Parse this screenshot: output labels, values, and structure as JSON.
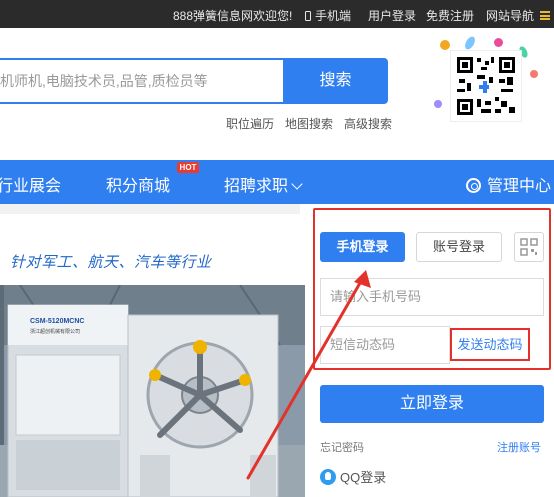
{
  "topbar": {
    "welcome": "888弹簧信息网欢迎您!",
    "mobile": "手机端",
    "login": "用户登录",
    "register": "免费注册",
    "sitenav": "网站导航",
    "menu_icon": "menu-icon",
    "phone_icon": "mobile-phone-icon"
  },
  "search": {
    "placeholder": "机师机,电脑技术员,品管,质检员等",
    "button": "搜索",
    "hotwords": [
      "职位遍历",
      "地图搜索",
      "高级搜索"
    ]
  },
  "nav": {
    "items": [
      "行业展会",
      "积分商城",
      "招聘求职"
    ],
    "hot_badge": "HOT",
    "admin": "管理中心"
  },
  "promo": {
    "headline": "针对军工、航天、汽车等行业",
    "machine_label": "CSM-5120MCNC",
    "machine_sub": "浙江超创机械有限公司"
  },
  "login": {
    "tab_phone": "手机登录",
    "tab_account": "账号登录",
    "phone_placeholder": "请输入手机号码",
    "code_placeholder": "短信动态码",
    "send_code": "发送动态码",
    "submit": "立即登录",
    "forgot": "忘记密码",
    "register": "注册账号",
    "qq": "QQ登录"
  },
  "colors": {
    "brand_blue": "#2f7ff0",
    "highlight_red": "#e3322b",
    "topbar_bg": "#2b2b2b"
  }
}
